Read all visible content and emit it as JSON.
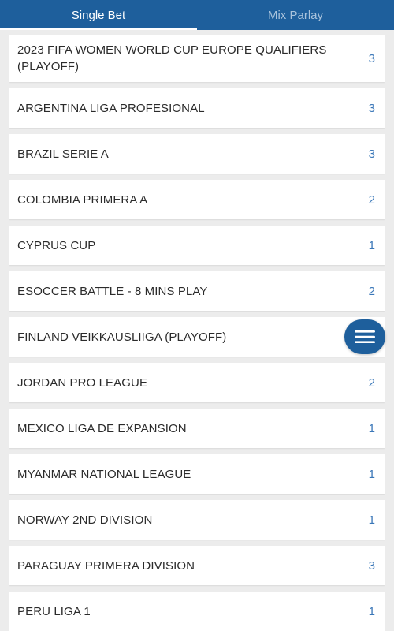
{
  "tabs": {
    "single_bet": "Single Bet",
    "mix_parlay": "Mix Parlay"
  },
  "leagues": [
    {
      "label": "2023 FIFA WOMEN WORLD CUP EUROPE QUALIFIERS (PLAYOFF)",
      "count": "3"
    },
    {
      "label": "ARGENTINA LIGA PROFESIONAL",
      "count": "3"
    },
    {
      "label": "BRAZIL SERIE A",
      "count": "3"
    },
    {
      "label": "COLOMBIA PRIMERA A",
      "count": "2"
    },
    {
      "label": "CYPRUS CUP",
      "count": "1"
    },
    {
      "label": "ESOCCER BATTLE - 8 MINS PLAY",
      "count": "2"
    },
    {
      "label": "FINLAND VEIKKAUSLIIGA (PLAYOFF)",
      "count": ""
    },
    {
      "label": "JORDAN PRO LEAGUE",
      "count": "2"
    },
    {
      "label": "MEXICO LIGA DE EXPANSION",
      "count": "1"
    },
    {
      "label": "MYANMAR NATIONAL LEAGUE",
      "count": "1"
    },
    {
      "label": "NORWAY 2ND DIVISION",
      "count": "1"
    },
    {
      "label": "PARAGUAY PRIMERA DIVISION",
      "count": "3"
    },
    {
      "label": "PERU LIGA 1",
      "count": "1"
    }
  ],
  "fab": {
    "icon": "menu-icon"
  },
  "colors": {
    "header_bg": "#1e5f9c",
    "count": "#3a77b8",
    "background": "#ececec"
  }
}
